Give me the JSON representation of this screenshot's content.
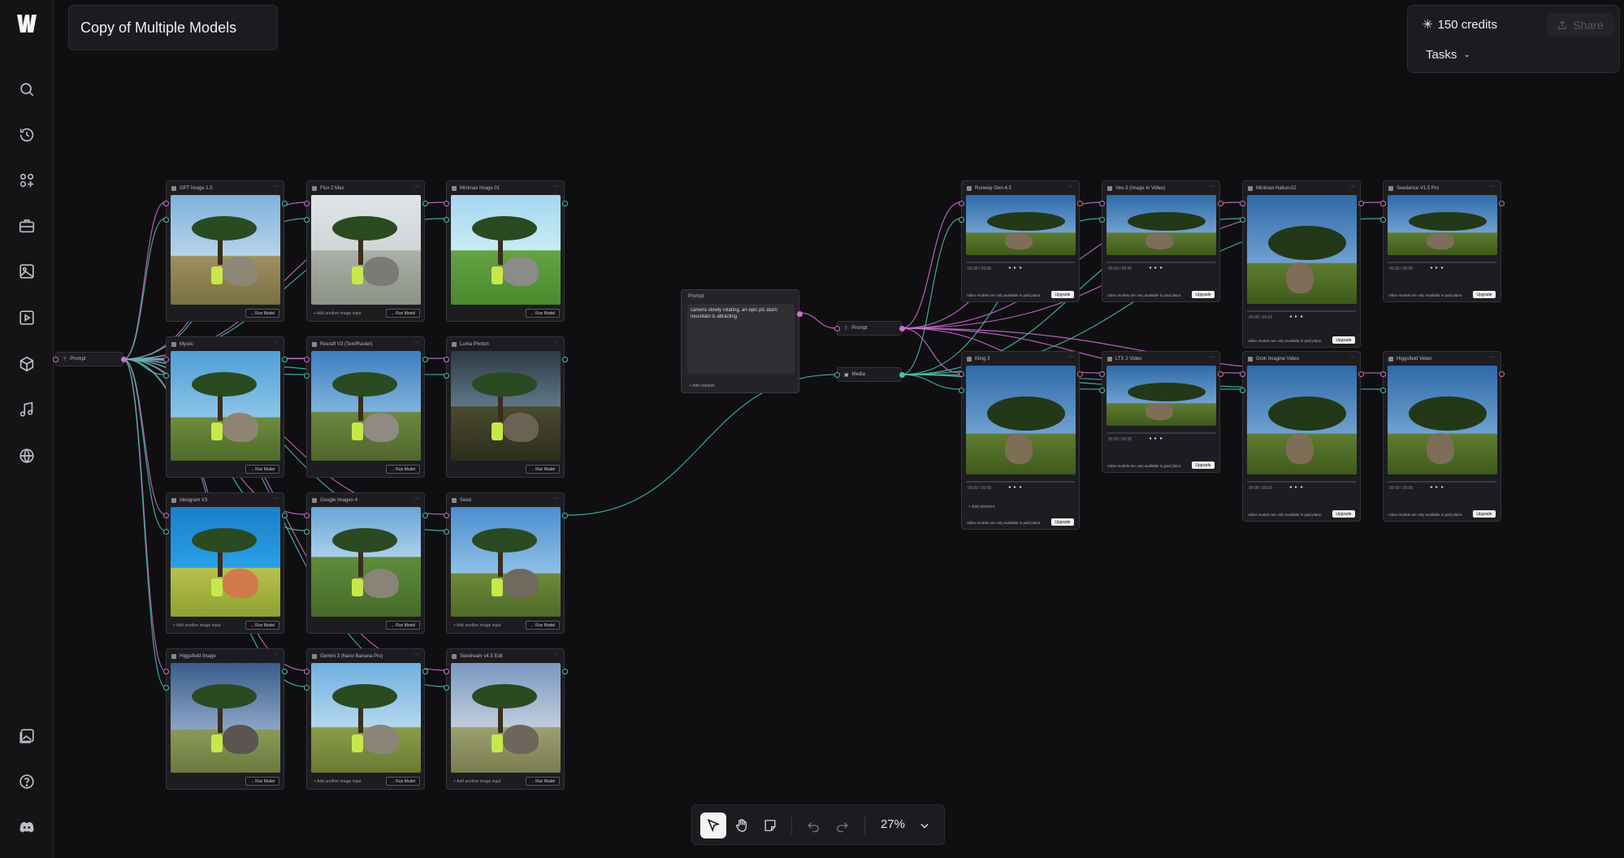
{
  "app": {
    "project_title": "Copy of Multiple Models",
    "credits": "150 credits",
    "share_label": "Share",
    "tasks_label": "Tasks"
  },
  "sidebar": {
    "items": [
      {
        "name": "search-icon"
      },
      {
        "name": "history-icon"
      },
      {
        "name": "apps-icon"
      },
      {
        "name": "briefcase-icon"
      },
      {
        "name": "image-icon"
      },
      {
        "name": "video-icon"
      },
      {
        "name": "cube-icon"
      },
      {
        "name": "music-icon"
      },
      {
        "name": "globe-icon"
      }
    ],
    "bottom": [
      {
        "name": "gallery-icon"
      },
      {
        "name": "help-icon"
      },
      {
        "name": "discord-icon"
      }
    ]
  },
  "canvas": {
    "left_prompt_label": "Prompt",
    "prompt_node": {
      "label": "Prompt",
      "text": "camera slowly rotating, an epic pic atam mountain is attracting",
      "footer": "+ Add variable"
    },
    "mid_nodes": {
      "prompt": "Prompt",
      "media": "Media"
    },
    "image_nodes": [
      {
        "title": "GPT Image 1.5",
        "run": "→ Run Model",
        "add": ""
      },
      {
        "title": "Flux 2 Max",
        "run": "→ Run Model",
        "add": "+ Add another image input"
      },
      {
        "title": "Minimax Image 01",
        "run": "→ Run Model",
        "add": ""
      },
      {
        "title": "Mystic",
        "run": "→ Run Model",
        "add": ""
      },
      {
        "title": "Recraft V3 (Text/Raster)",
        "run": "→ Run Model",
        "add": ""
      },
      {
        "title": "Luma Photon",
        "run": "→ Run Model",
        "add": ""
      },
      {
        "title": "Ideogram V3",
        "run": "→ Run Model",
        "add": "+ Add another image input"
      },
      {
        "title": "Google Imagen 4",
        "run": "→ Run Model",
        "add": ""
      },
      {
        "title": "Seed",
        "run": "→ Run Model",
        "add": "+ Add another image input"
      },
      {
        "title": "Higgsfield Image",
        "run": "→ Run Model",
        "add": ""
      },
      {
        "title": "Gemini 3 (Nano Banana Pro)",
        "run": "→ Run Model",
        "add": "+ Add another image input"
      },
      {
        "title": "Seedream v4.5 Edit",
        "run": "→ Run Model",
        "add": "+ Add another image input"
      }
    ],
    "video_nodes": [
      {
        "title": "Runway Gen-4.5",
        "note": "Video models are only available in paid plans.",
        "upgrade": "Upgrade",
        "time": "00:00 / 00:00"
      },
      {
        "title": "Veo 3 (Image to Video)",
        "note": "Video models are only available in paid plans.",
        "upgrade": "Upgrade",
        "time": "00:00 / 00:00"
      },
      {
        "title": "Minimax Hailuo-02",
        "note": "Video models are only available in paid plans.",
        "upgrade": "Upgrade",
        "time": "00:00 / 00:00"
      },
      {
        "title": "Seedance V1.5 Pro",
        "note": "Video models are only available in paid plans.",
        "upgrade": "Upgrade",
        "time": "00:00 / 00:00"
      },
      {
        "title": "Kling 3",
        "note": "Video models are only available in paid plans.",
        "upgrade": "Upgrade",
        "time": "00:00 / 00:00",
        "extra": "+ Add element"
      },
      {
        "title": "LTX 2 Video",
        "note": "Video models are only available in paid plans.",
        "upgrade": "Upgrade",
        "time": "00:00 / 00:00"
      },
      {
        "title": "Grok Imagine Video",
        "note": "Video models are only available in paid plans.",
        "upgrade": "Upgrade",
        "time": "00:00 / 00:00"
      },
      {
        "title": "Higgsfield Video",
        "note": "Video models are only available in paid plans.",
        "upgrade": "Upgrade",
        "time": "00:00 / 00:00"
      }
    ]
  },
  "toolbar": {
    "tools": [
      "select-tool-icon",
      "hand-tool-icon",
      "sticky-note-icon",
      "undo-icon",
      "redo-icon"
    ],
    "zoom": "27%"
  },
  "colors": {
    "background": "#0f0f12",
    "node": "#1d1d21",
    "edge_pink": "#d16fd6",
    "edge_green": "#49c3a4"
  }
}
